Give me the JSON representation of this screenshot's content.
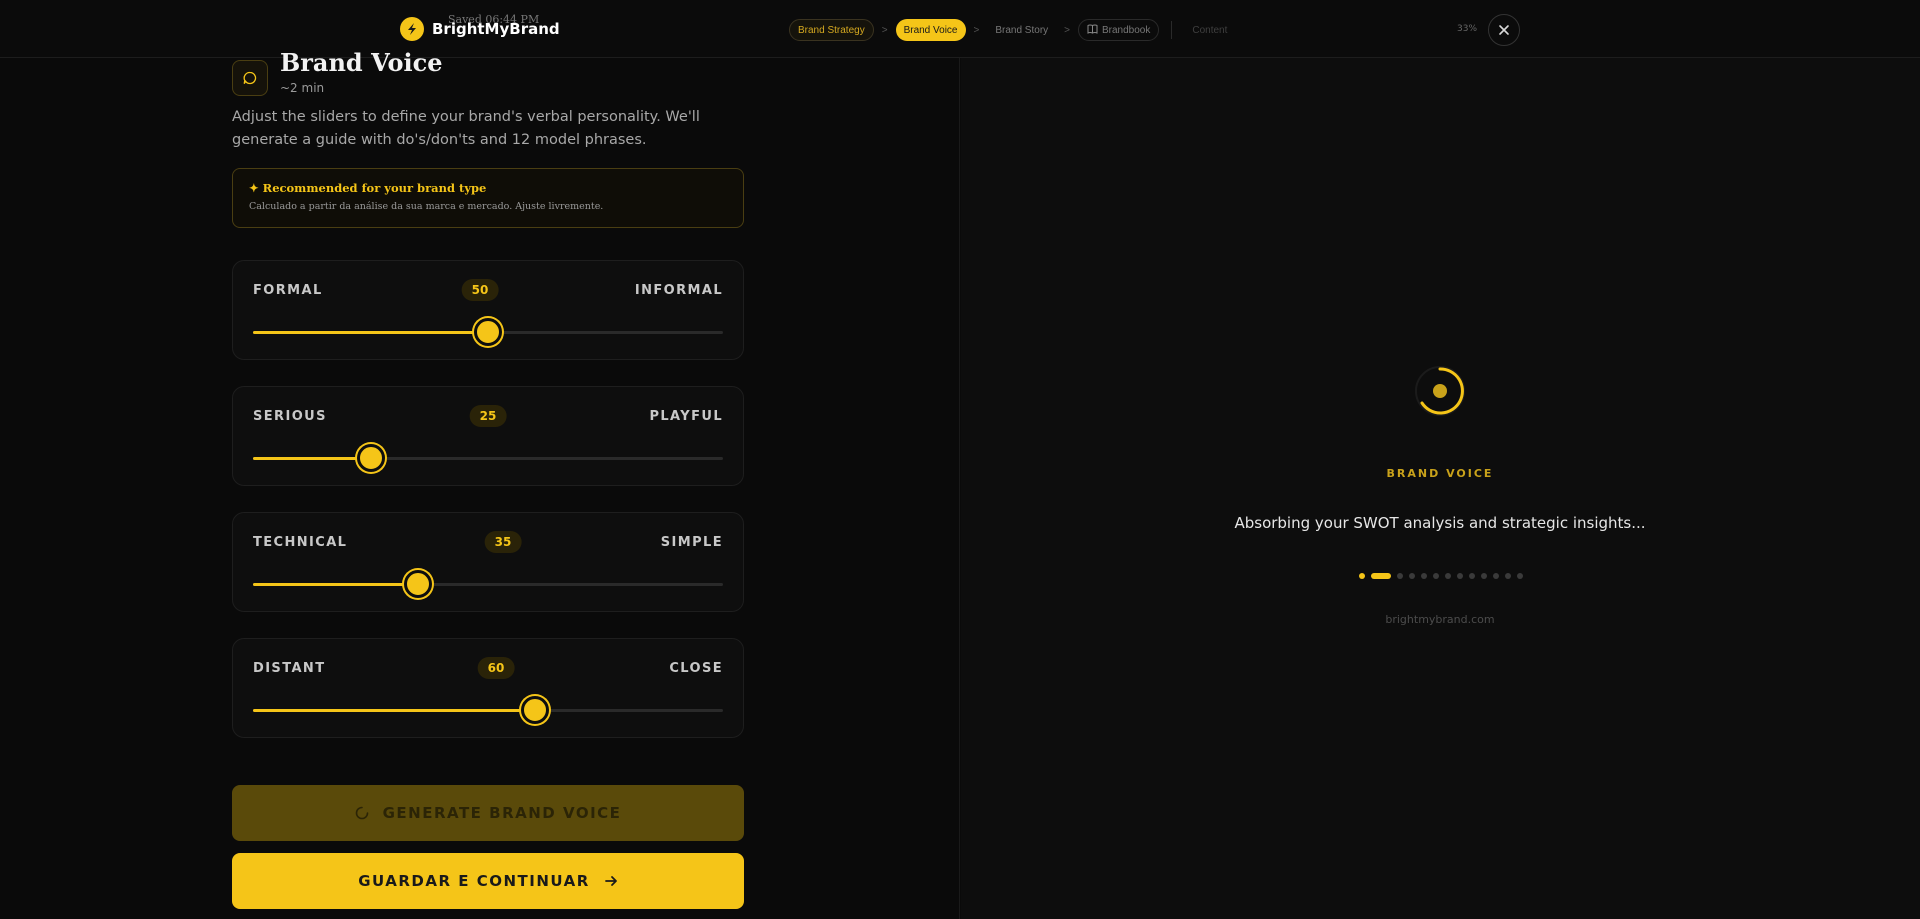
{
  "header": {
    "saved_text": "Saved 06:44 PM",
    "brand_name": "BrightMyBrand",
    "progress_percent": "33%",
    "progress_fraction": 0.33,
    "steps": [
      {
        "label": "Brand Strategy",
        "state": "done"
      },
      {
        "label": "Brand Voice",
        "state": "active"
      },
      {
        "label": "Brand Story",
        "state": "upcoming"
      },
      {
        "label": "Brandbook",
        "state": "upcoming"
      },
      {
        "label": "Content",
        "state": "locked"
      }
    ],
    "separator": ">"
  },
  "page": {
    "title": "Brand Voice",
    "duration": "~2 min",
    "description": "Adjust the sliders to define your brand's verbal personality. We'll generate a guide with do's/don'ts and 12 model phrases."
  },
  "recommendation": {
    "title": "✦ Recommended for your brand type",
    "subtitle": "Calculado a partir da análise da sua marca e mercado. Ajuste livremente."
  },
  "sliders": [
    {
      "left": "FORMAL",
      "right": "INFORMAL",
      "value": 50
    },
    {
      "left": "SERIOUS",
      "right": "PLAYFUL",
      "value": 25
    },
    {
      "left": "TECHNICAL",
      "right": "SIMPLE",
      "value": 35
    },
    {
      "left": "DISTANT",
      "right": "CLOSE",
      "value": 60
    }
  ],
  "actions": {
    "generate_label": "GENERATE BRAND VOICE",
    "save_label": "GUARDAR E CONTINUAR"
  },
  "preview": {
    "section_label": "BRAND VOICE",
    "status": "Absorbing your SWOT analysis and strategic insights...",
    "footer": "brightmybrand.com",
    "dots_total": 13,
    "dots_active_index": 1
  },
  "colors": {
    "accent": "#f5c518",
    "background": "#0a0a0a"
  },
  "icons": {
    "logo": "lightning-bolt-icon",
    "title": "chat-bubble-icon",
    "brandbook": "book-icon",
    "close": "close-icon",
    "generate": "loading-spinner-icon",
    "save": "arrow-right-icon"
  }
}
